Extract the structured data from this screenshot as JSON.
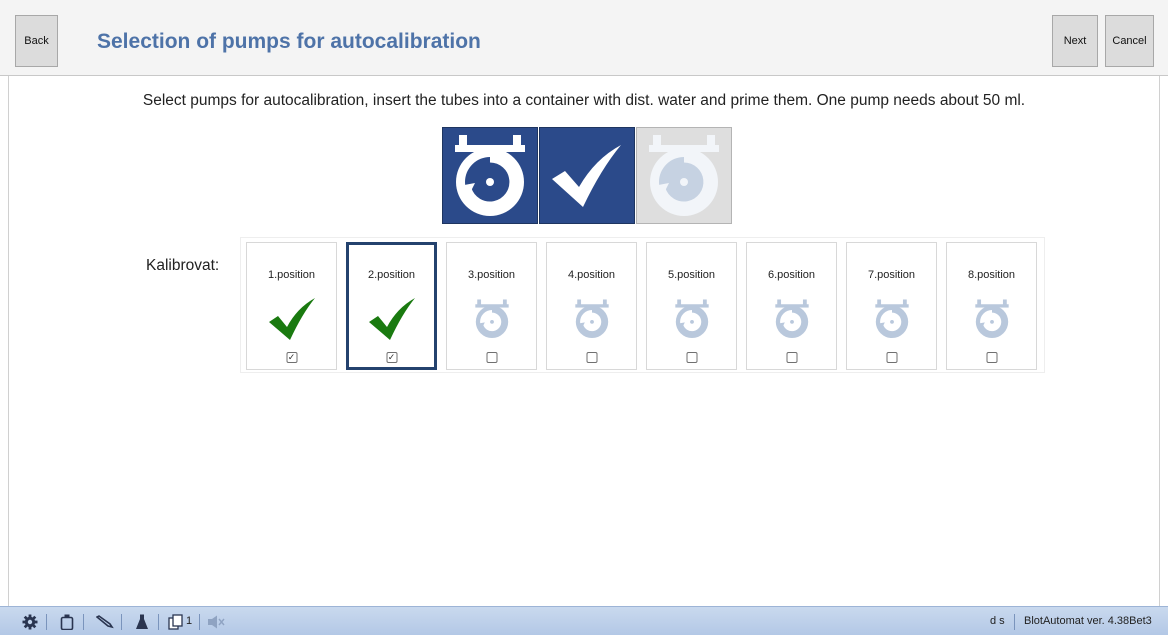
{
  "header": {
    "back_label": "Back",
    "title": "Selection of pumps for autocalibration",
    "next_label": "Next",
    "cancel_label": "Cancel"
  },
  "instructions": "Select pumps for autocalibration, insert the tubes into  a container with dist. water and prime them. One pump needs about 50 ml.",
  "big_icons": [
    {
      "name": "pump-icon",
      "state": "active"
    },
    {
      "name": "checkmark-icon",
      "state": "active"
    },
    {
      "name": "pump-icon",
      "state": "disabled"
    }
  ],
  "calibrate_label": "Kalibrovat:",
  "positions": [
    {
      "label": "1.position",
      "checked": true,
      "icon": "checkmark-icon"
    },
    {
      "label": "2.position",
      "checked": true,
      "icon": "checkmark-icon"
    },
    {
      "label": "3.position",
      "checked": false,
      "icon": "pump-icon"
    },
    {
      "label": "4.position",
      "checked": false,
      "icon": "pump-icon"
    },
    {
      "label": "5.position",
      "checked": false,
      "icon": "pump-icon"
    },
    {
      "label": "6.position",
      "checked": false,
      "icon": "pump-icon"
    },
    {
      "label": "7.position",
      "checked": false,
      "icon": "pump-icon"
    },
    {
      "label": "8.position",
      "checked": false,
      "icon": "pump-icon"
    }
  ],
  "selected_position": "2.position",
  "status": {
    "icons": [
      "gear-icon",
      "bottle-icon",
      "pipette-icon",
      "flask-icon",
      "documents-icon",
      "speaker-muted-icon"
    ],
    "documents_count": "1",
    "user": "d s",
    "version": "BlotAutomat ver. 4.38Bet3"
  },
  "colors": {
    "title": "#4e73a8",
    "tile_active": "#2b4a8a",
    "check_green": "#1a7a10",
    "pump_disabled": "#b9c8dc",
    "status_bar": "#b3c8e6"
  }
}
